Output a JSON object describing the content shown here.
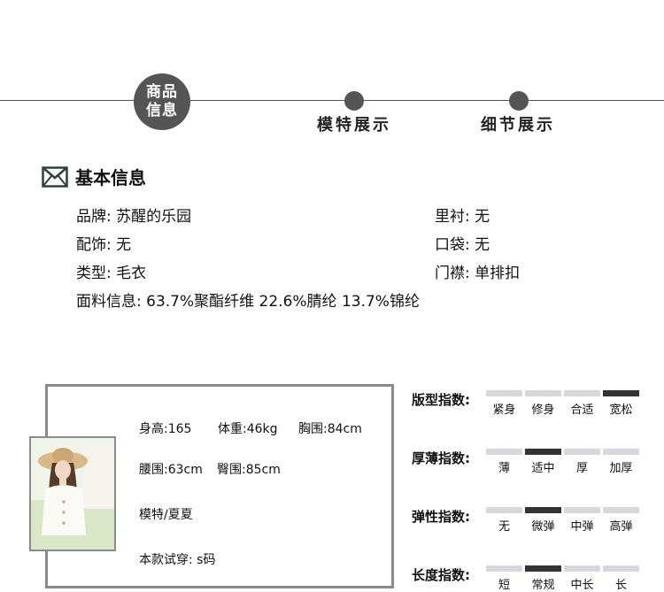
{
  "timeline": {
    "active_line1": "商品",
    "active_line2": "信息",
    "step2": "模特展示",
    "step3": "细节展示"
  },
  "basic_info": {
    "title": "基本信息",
    "icon": "envelope-icon",
    "rows": [
      {
        "key": "品牌:",
        "value": "苏醒的乐园"
      },
      {
        "key": "里衬:",
        "value": "无"
      },
      {
        "key": "配饰:",
        "value": "无"
      },
      {
        "key": "口袋:",
        "value": "无"
      },
      {
        "key": "类型:",
        "value": "毛衣"
      },
      {
        "key": "门襟:",
        "value": "单排扣"
      },
      {
        "key": "面料信息:",
        "value": "63.7%聚酯纤维 22.6%腈纶 13.7%锦纶"
      }
    ]
  },
  "model": {
    "height": "身高:165",
    "weight": "体重:46kg",
    "bust": "胸围:84cm",
    "waist": "腰围:63cm",
    "hip": "臀围:85cm",
    "name": "模特/夏夏",
    "size_tried": "本款试穿: s码"
  },
  "indices": {
    "colors": {
      "active": "#333333",
      "inactive": "#d5d8dc"
    },
    "items": [
      {
        "label": "版型指数:",
        "options": [
          "紧身",
          "修身",
          "合适",
          "宽松"
        ],
        "selected": 3
      },
      {
        "label": "厚薄指数:",
        "options": [
          "薄",
          "适中",
          "厚",
          "加厚"
        ],
        "selected": 1
      },
      {
        "label": "弹性指数:",
        "options": [
          "无",
          "微弹",
          "中弹",
          "高弹"
        ],
        "selected": 1
      },
      {
        "label": "长度指数:",
        "options": [
          "短",
          "常规",
          "中长",
          "长"
        ],
        "selected": 1
      }
    ]
  }
}
